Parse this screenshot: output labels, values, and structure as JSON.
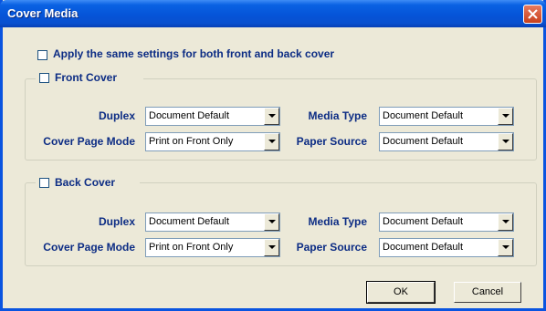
{
  "window": {
    "title": "Cover Media"
  },
  "apply_same": {
    "label": "Apply the same settings for both front and back cover",
    "checked": false
  },
  "front": {
    "title": "Front Cover",
    "checked": false,
    "duplex_label": "Duplex",
    "duplex_value": "Document Default",
    "mode_label": "Cover Page Mode",
    "mode_value": "Print on Front Only",
    "media_label": "Media Type",
    "media_value": "Document Default",
    "source_label": "Paper Source",
    "source_value": "Document Default"
  },
  "back": {
    "title": "Back Cover",
    "checked": false,
    "duplex_label": "Duplex",
    "duplex_value": "Document Default",
    "mode_label": "Cover Page Mode",
    "mode_value": "Print on Front Only",
    "media_label": "Media Type",
    "media_value": "Document Default",
    "source_label": "Paper Source",
    "source_value": "Document Default"
  },
  "buttons": {
    "ok": "OK",
    "cancel": "Cancel"
  }
}
